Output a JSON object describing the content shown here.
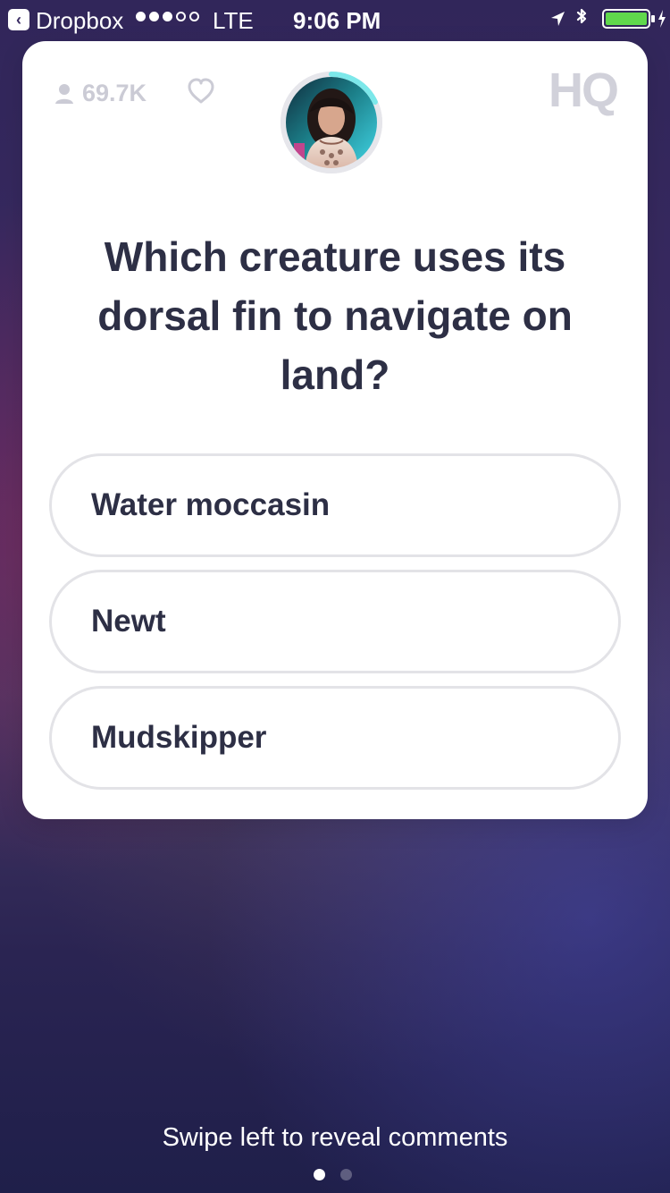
{
  "status_bar": {
    "back_app_label": "Dropbox",
    "network": "LTE",
    "time": "9:06 PM",
    "signal_strength": "3 of 5",
    "battery_level": "high",
    "icons": [
      "back-chevron-icon",
      "location-icon",
      "bluetooth-icon",
      "battery-icon",
      "charging-icon"
    ]
  },
  "game_card": {
    "viewers": "69.7K",
    "heart_icon": "heart-icon",
    "logo": "HQ",
    "question": "Which creature uses its dorsal fin to navigate on land?",
    "answers": [
      {
        "label": "Water moccasin"
      },
      {
        "label": "Newt"
      },
      {
        "label": "Mudskipper"
      }
    ],
    "timer_progress": 0.18
  },
  "footer": {
    "hint": "Swipe left to reveal comments",
    "current_page": 1,
    "total_pages": 2
  },
  "colors": {
    "card_bg": "#ffffff",
    "card_text": "#2d2f45",
    "muted_gray": "#cbcbd5",
    "accent_teal": "#7ce8ea",
    "battery_green": "#60d84c"
  }
}
